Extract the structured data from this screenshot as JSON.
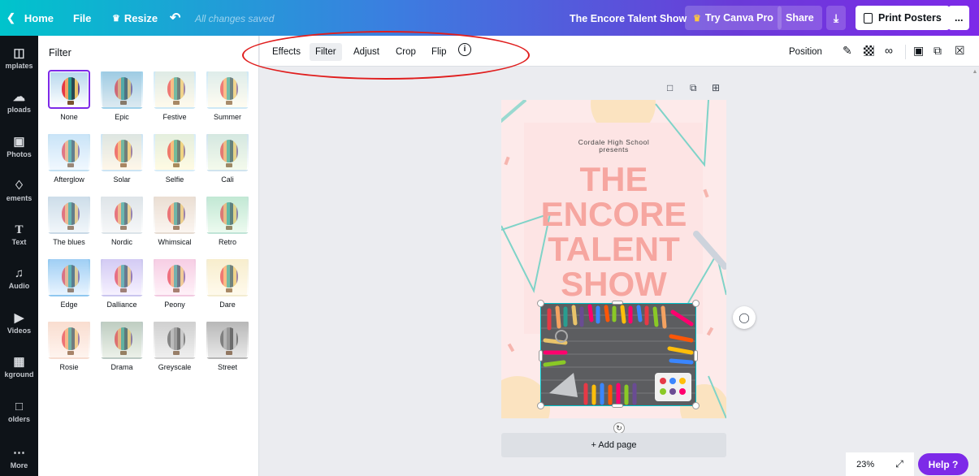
{
  "topbar": {
    "home": "Home",
    "file": "File",
    "resize": "Resize",
    "saved_status": "All changes saved",
    "doc_title": "The Encore Talent Show",
    "try_pro": "Try Canva Pro",
    "share": "Share",
    "print": "Print Posters",
    "more": "..."
  },
  "rail": [
    {
      "label": "mplates",
      "icon": "templates-icon"
    },
    {
      "label": "ploads",
      "icon": "uploads-icon"
    },
    {
      "label": "Photos",
      "icon": "photos-icon"
    },
    {
      "label": "ements",
      "icon": "elements-icon"
    },
    {
      "label": "Text",
      "icon": "text-icon"
    },
    {
      "label": "Audio",
      "icon": "audio-icon"
    },
    {
      "label": "Videos",
      "icon": "videos-icon"
    },
    {
      "label": "kground",
      "icon": "background-icon"
    },
    {
      "label": "olders",
      "icon": "folders-icon"
    },
    {
      "label": "More",
      "icon": "more-icon"
    }
  ],
  "panel": {
    "title": "Filter",
    "filters": [
      "None",
      "Epic",
      "Festive",
      "Summer",
      "Afterglow",
      "Solar",
      "Selfie",
      "Cali",
      "The blues",
      "Nordic",
      "Whimsical",
      "Retro",
      "Edge",
      "Dalliance",
      "Peony",
      "Dare",
      "Rosie",
      "Drama",
      "Greyscale",
      "Street"
    ],
    "selected": "None"
  },
  "toolbar": {
    "effects": "Effects",
    "filter": "Filter",
    "adjust": "Adjust",
    "crop": "Crop",
    "flip": "Flip",
    "position": "Position"
  },
  "poster": {
    "school": "Cordale High School",
    "presents": "presents",
    "line1": "THE",
    "line2": "ENCORE",
    "line3": "TALENT",
    "line4": "SHOW"
  },
  "add_page": "+ Add page",
  "zoom": "23%",
  "help": "Help ?",
  "colors": {
    "accent": "#7d2ae8",
    "poster_bg": "#fdeaea",
    "poster_title": "#f6a6a0",
    "annotation": "#e01e1e"
  }
}
